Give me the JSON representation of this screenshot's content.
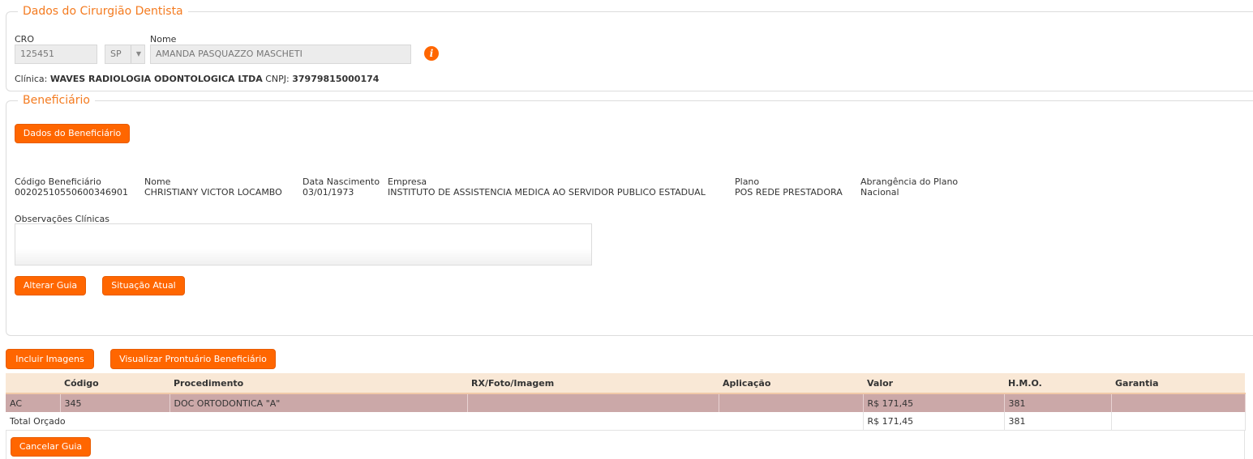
{
  "dentist": {
    "legend": "Dados do Cirurgião Dentista",
    "cro_label": "CRO",
    "cro_value": "125451",
    "uf_value": "SP",
    "name_label": "Nome",
    "name_value": "AMANDA PASQUAZZO MASCHETI",
    "info_icon_glyph": "i",
    "clinic_prefix": "Clínica:",
    "clinic_name": "WAVES RADIOLOGIA ODONTOLOGICA LTDA",
    "cnpj_prefix": "CNPJ:",
    "cnpj_value": "37979815000174"
  },
  "beneficiary": {
    "legend": "Beneficiário",
    "details_button": "Dados do Beneficiário",
    "code_label": "Código Beneficiário",
    "code_value": "0020251055060034690​1",
    "name_label": "Nome",
    "name_value": "CHRISTIANY VICTOR LOCAMBO",
    "birth_label": "Data Nascimento",
    "birth_value": "03/01/1973",
    "company_label": "Empresa",
    "company_value": "INSTITUTO DE ASSISTENCIA MEDICA AO SERVIDOR PUBLICO ESTADUAL",
    "plan_label": "Plano",
    "plan_value": "POS REDE PRESTADORA",
    "coverage_label": "Abrangência do Plano",
    "coverage_value": "Nacional",
    "notes_label": "Observações Clínicas",
    "notes_value": "",
    "alter_button": "Alterar Guia",
    "status_button": "Situação Atual"
  },
  "actions": {
    "include_images": "Incluir Imagens",
    "view_records": "Visualizar Prontuário Beneficiário",
    "cancel": "Cancelar Guia"
  },
  "table": {
    "headers": [
      "",
      "Código",
      "Procedimento",
      "RX/Foto/Imagem",
      "Aplicação",
      "Valor",
      "H.M.O.",
      "Garantia"
    ],
    "rows": [
      {
        "type": "AC",
        "code": "345",
        "procedure": "DOC ORTODONTICA \"A\"",
        "rx": "",
        "application": "",
        "value": "R$ 171,45",
        "hmo": "381",
        "warranty": ""
      }
    ],
    "total_label": "Total Orçado",
    "total_value": "R$ 171,45",
    "total_hmo": "381"
  },
  "colors": {
    "accent": "#ff6600",
    "legend": "#f47b20",
    "header_bg": "#f9e8d6",
    "selected_row": "#cba8a8"
  }
}
